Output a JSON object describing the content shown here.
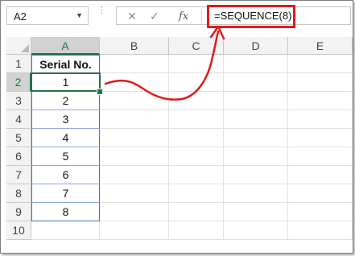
{
  "name_box": {
    "value": "A2",
    "dropdown_icon": "chevron-down-icon"
  },
  "formula_bar": {
    "cancel_icon": "✕",
    "enter_icon": "✓",
    "function_label": "fx",
    "formula": "=SEQUENCE(8)"
  },
  "columns": [
    "A",
    "B",
    "C",
    "D",
    "E"
  ],
  "rows": [
    "1",
    "2",
    "3",
    "4",
    "5",
    "6",
    "7",
    "8",
    "9",
    "10"
  ],
  "column_a": {
    "header": "Serial No.",
    "values": [
      "1",
      "2",
      "3",
      "4",
      "5",
      "6",
      "7",
      "8"
    ]
  },
  "colors": {
    "highlight": "#e21a1a",
    "selection": "#217346",
    "table_border": "#4472c4"
  }
}
